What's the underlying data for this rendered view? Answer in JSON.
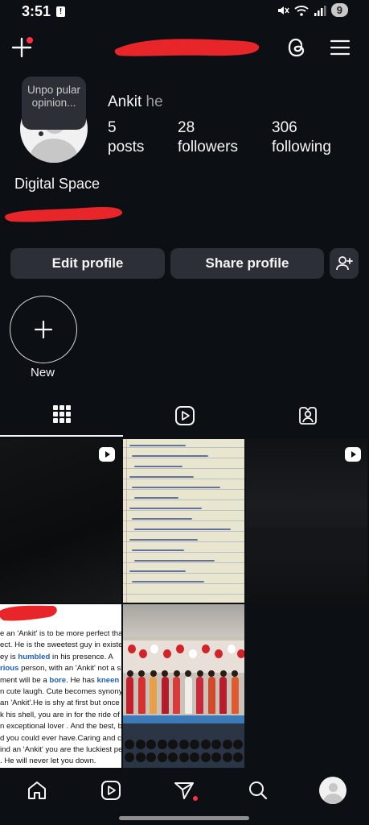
{
  "status_bar": {
    "time": "3:51",
    "alert": "!",
    "battery": "9"
  },
  "profile": {
    "username": "Ankit",
    "username_suffix": "he",
    "note": "Unpo pular opinion...",
    "full_name": "Digital Space",
    "stats": [
      {
        "value": "5",
        "label": "posts"
      },
      {
        "value": "28",
        "label": "followers"
      },
      {
        "value": "306",
        "label": "following"
      }
    ]
  },
  "buttons": {
    "edit": "Edit profile",
    "share": "Share profile"
  },
  "highlights": {
    "new_label": "New"
  },
  "tabs": [
    {
      "name": "grid",
      "icon": "grid-icon",
      "active": true
    },
    {
      "name": "reels",
      "icon": "reels-icon",
      "active": false
    },
    {
      "name": "tagged",
      "icon": "tagged-icon",
      "active": false
    }
  ],
  "text_post": {
    "lines": [
      [
        "e an 'Ankit' is to be more perfect than"
      ],
      [
        "ect. He is the sweetest guy in existence"
      ],
      [
        "ey is ",
        {
          "hl": "humbled"
        },
        " in his presence. A"
      ],
      [
        {
          "hl": "rious"
        },
        " person, with an 'Ankit' not a sin"
      ],
      [
        "ment will be a ",
        {
          "hl": "bore"
        },
        ". He has ",
        {
          "hl": "kneen"
        },
        " eye"
      ],
      [
        "n cute laugh. Cute becomes synonym"
      ],
      [
        "an 'Ankit'.He is shy at first but once u"
      ],
      [
        "k his shell, you are in for the ride of yo"
      ],
      [
        "n exceptional lover . And the best, be"
      ],
      [
        "d you could ever have.Caring and cut"
      ],
      [
        "ind an 'Ankit' you are the luckiest pe"
      ],
      [
        ". He will never let you down."
      ]
    ]
  },
  "colors": {
    "background": "#0c1014",
    "button": "#2c3036",
    "notification": "#ff3040",
    "redaction": "#e8262a"
  },
  "nav": [
    "home-icon",
    "reels-icon",
    "direct-icon",
    "search-icon",
    "profile-avatar"
  ]
}
